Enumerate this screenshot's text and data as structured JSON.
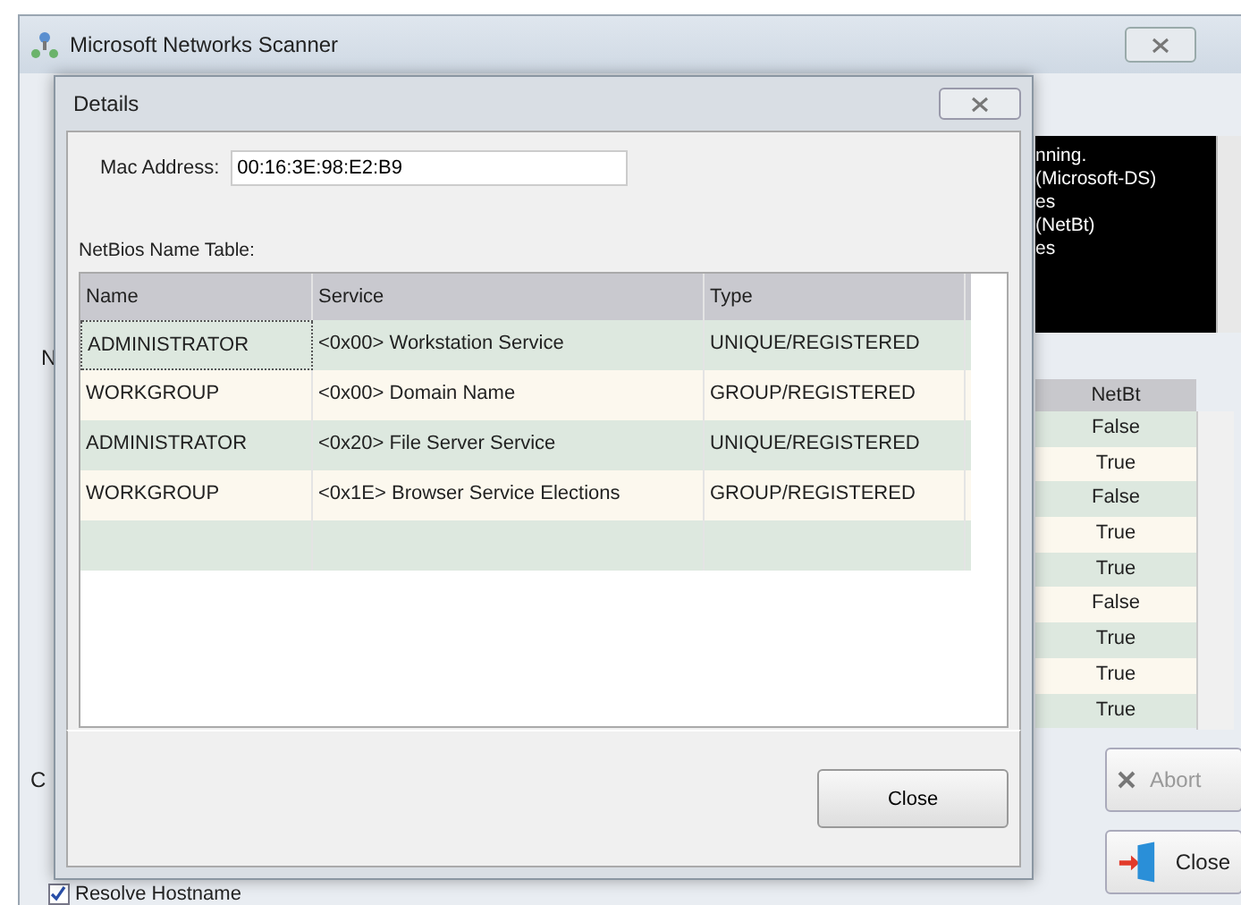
{
  "window": {
    "title": "Microsoft Networks Scanner"
  },
  "log": {
    "lines": [
      "nning.",
      "(Microsoft-DS)",
      "es",
      "(NetBt)",
      "es"
    ]
  },
  "left_labels": [
    "N",
    "C"
  ],
  "results": {
    "column": "NetBt",
    "values": [
      "False",
      "True",
      "False",
      "True",
      "True",
      "False",
      "True",
      "True",
      "True"
    ]
  },
  "buttons": [
    {
      "label": "Abort",
      "kind": "abort",
      "disabled": true
    },
    {
      "label": "Close",
      "kind": "close",
      "disabled": false
    }
  ],
  "options": [
    {
      "label": "Resolve Hostname",
      "checked": true
    }
  ],
  "dialog": {
    "title": "Details",
    "mac_label": "Mac Address:",
    "mac_value": "00:16:3E:98:E2:B9",
    "table_label": "NetBios Name Table:",
    "columns": [
      "Name",
      "Service",
      "Type"
    ],
    "rows": [
      {
        "cells": [
          "ADMINISTRATOR",
          "<0x00> Workstation Service",
          "UNIQUE/REGISTERED"
        ],
        "focused": true
      },
      {
        "cells": [
          "WORKGROUP",
          "<0x00> Domain Name",
          "GROUP/REGISTERED"
        ],
        "focused": false
      },
      {
        "cells": [
          "ADMINISTRATOR",
          "<0x20> File Server Service",
          "UNIQUE/REGISTERED"
        ],
        "focused": false
      },
      {
        "cells": [
          "WORKGROUP",
          "<0x1E> Browser Service Elections",
          "GROUP/REGISTERED"
        ],
        "focused": false
      }
    ],
    "close_button": "Close"
  }
}
